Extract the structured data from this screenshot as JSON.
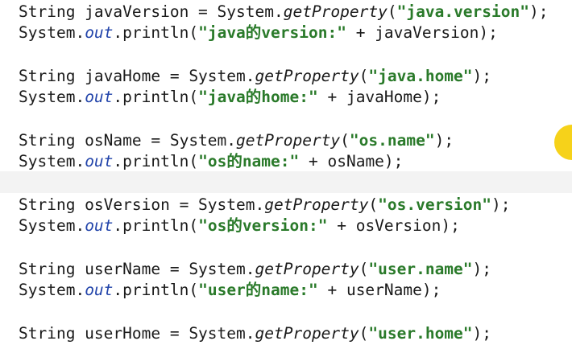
{
  "lines": [
    {
      "code": "String javaVersion = System.getProperty(\"java.version\");"
    },
    {
      "code": "System.out.println(\"java的version:\" + javaVersion);"
    },
    {
      "code": "String javaHome = System.getProperty(\"java.home\");"
    },
    {
      "code": "System.out.println(\"java的home:\" + javaHome);"
    },
    {
      "code": "String osName = System.getProperty(\"os.name\");"
    },
    {
      "code": "System.out.println(\"os的name:\" + osName);"
    },
    {
      "code": "String osVersion = System.getProperty(\"os.version\");"
    },
    {
      "code": "System.out.println(\"os的version:\" + osVersion);"
    },
    {
      "code": "String userName = System.getProperty(\"user.name\");"
    },
    {
      "code": "System.out.println(\"user的name:\" + userName);"
    },
    {
      "code": "String userHome = System.getProperty(\"user.home\");"
    }
  ],
  "colors": {
    "string": "#2a7a2a",
    "field": "#2244aa",
    "highlight": "#f3f3f3",
    "marker": "#f6d21a"
  }
}
